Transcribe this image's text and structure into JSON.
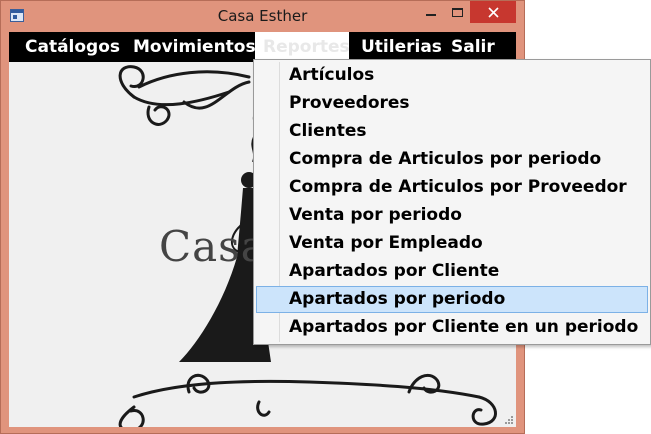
{
  "window": {
    "title": "Casa Esther",
    "accent_color": "#e0947d",
    "close_color": "#c7372f"
  },
  "menubar": {
    "items": [
      "Catálogos",
      "Movimientos",
      "Reportes",
      "Utilerias",
      "Salir"
    ],
    "open_item": "Reportes"
  },
  "background_art": {
    "brand_text": "Casa",
    "icons": [
      "flourish-ornament-icon",
      "dress-silhouette-icon"
    ]
  },
  "reportes_menu": {
    "items": [
      "Artículos",
      "Proveedores",
      "Clientes",
      "Compra de Articulos por periodo",
      "Compra de Articulos por Proveedor",
      "Venta por periodo",
      "Venta por Empleado",
      "Apartados por Cliente",
      "Apartados por periodo",
      "Apartados por Cliente en un periodo"
    ],
    "highlighted": "Apartados por periodo",
    "highlight_color": "#cce4fb"
  }
}
